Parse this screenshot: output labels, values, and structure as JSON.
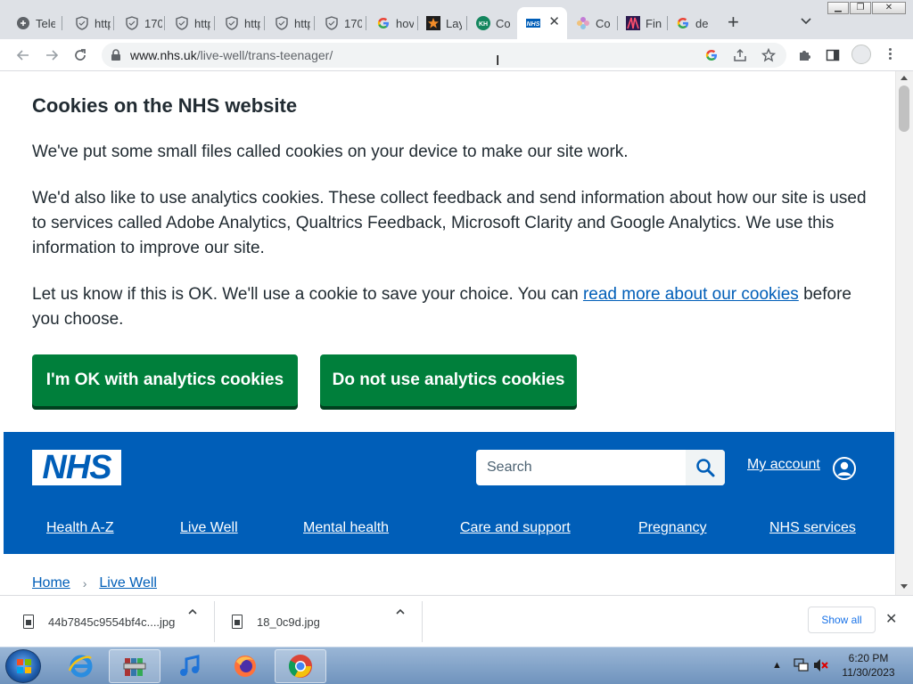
{
  "tabs": [
    {
      "title": "Tele",
      "icon": "web-icon"
    },
    {
      "title": "http",
      "icon": "shield-icon"
    },
    {
      "title": "170",
      "icon": "shield-icon"
    },
    {
      "title": "http",
      "icon": "shield-icon"
    },
    {
      "title": "http",
      "icon": "shield-icon"
    },
    {
      "title": "http",
      "icon": "shield-icon"
    },
    {
      "title": "170",
      "icon": "shield-icon"
    },
    {
      "title": "hov",
      "icon": "google-icon"
    },
    {
      "title": "Lay",
      "icon": "star-icon"
    },
    {
      "title": "Co",
      "icon": "kh-icon"
    },
    {
      "title": "NHS",
      "icon": "nhs-icon",
      "active": true
    },
    {
      "title": "Co",
      "icon": "flower-icon"
    },
    {
      "title": "Fin",
      "icon": "fin-icon"
    },
    {
      "title": "de",
      "icon": "google-icon"
    }
  ],
  "address": {
    "domain": "www.nhs.uk",
    "path": "/live-well/trans-teenager/"
  },
  "cookie_banner": {
    "title": "Cookies on the NHS website",
    "p1": "We've put some small files called cookies on your device to make our site work.",
    "p2": "We'd also like to use analytics cookies. These collect feedback and send information about how our site is used to services called Adobe Analytics, Qualtrics Feedback, Microsoft Clarity and Google Analytics. We use this information to improve our site.",
    "p3_before": "Let us know if this is OK. We'll use a cookie to save your choice. You can ",
    "p3_link": "read more about our cookies",
    "p3_after": " before you choose.",
    "accept_label": "I'm OK with analytics cookies",
    "reject_label": "Do not use analytics cookies"
  },
  "header": {
    "logo_text": "NHS",
    "search_placeholder": "Search",
    "account_label": "My account",
    "nav": [
      "Health A-Z",
      "Live Well",
      "Mental health",
      "Care and support",
      "Pregnancy",
      "NHS services"
    ]
  },
  "breadcrumb": [
    "Home",
    "Live Well"
  ],
  "downloads": {
    "items": [
      "44b7845c9554bf4c....jpg",
      "18_0c9d.jpg"
    ],
    "show_all": "Show all"
  },
  "taskbar": {
    "time": "6:20 PM",
    "date": "11/30/2023"
  },
  "colors": {
    "nhs_blue": "#005eb8",
    "nhs_green": "#007f3b",
    "text": "#212b32"
  }
}
